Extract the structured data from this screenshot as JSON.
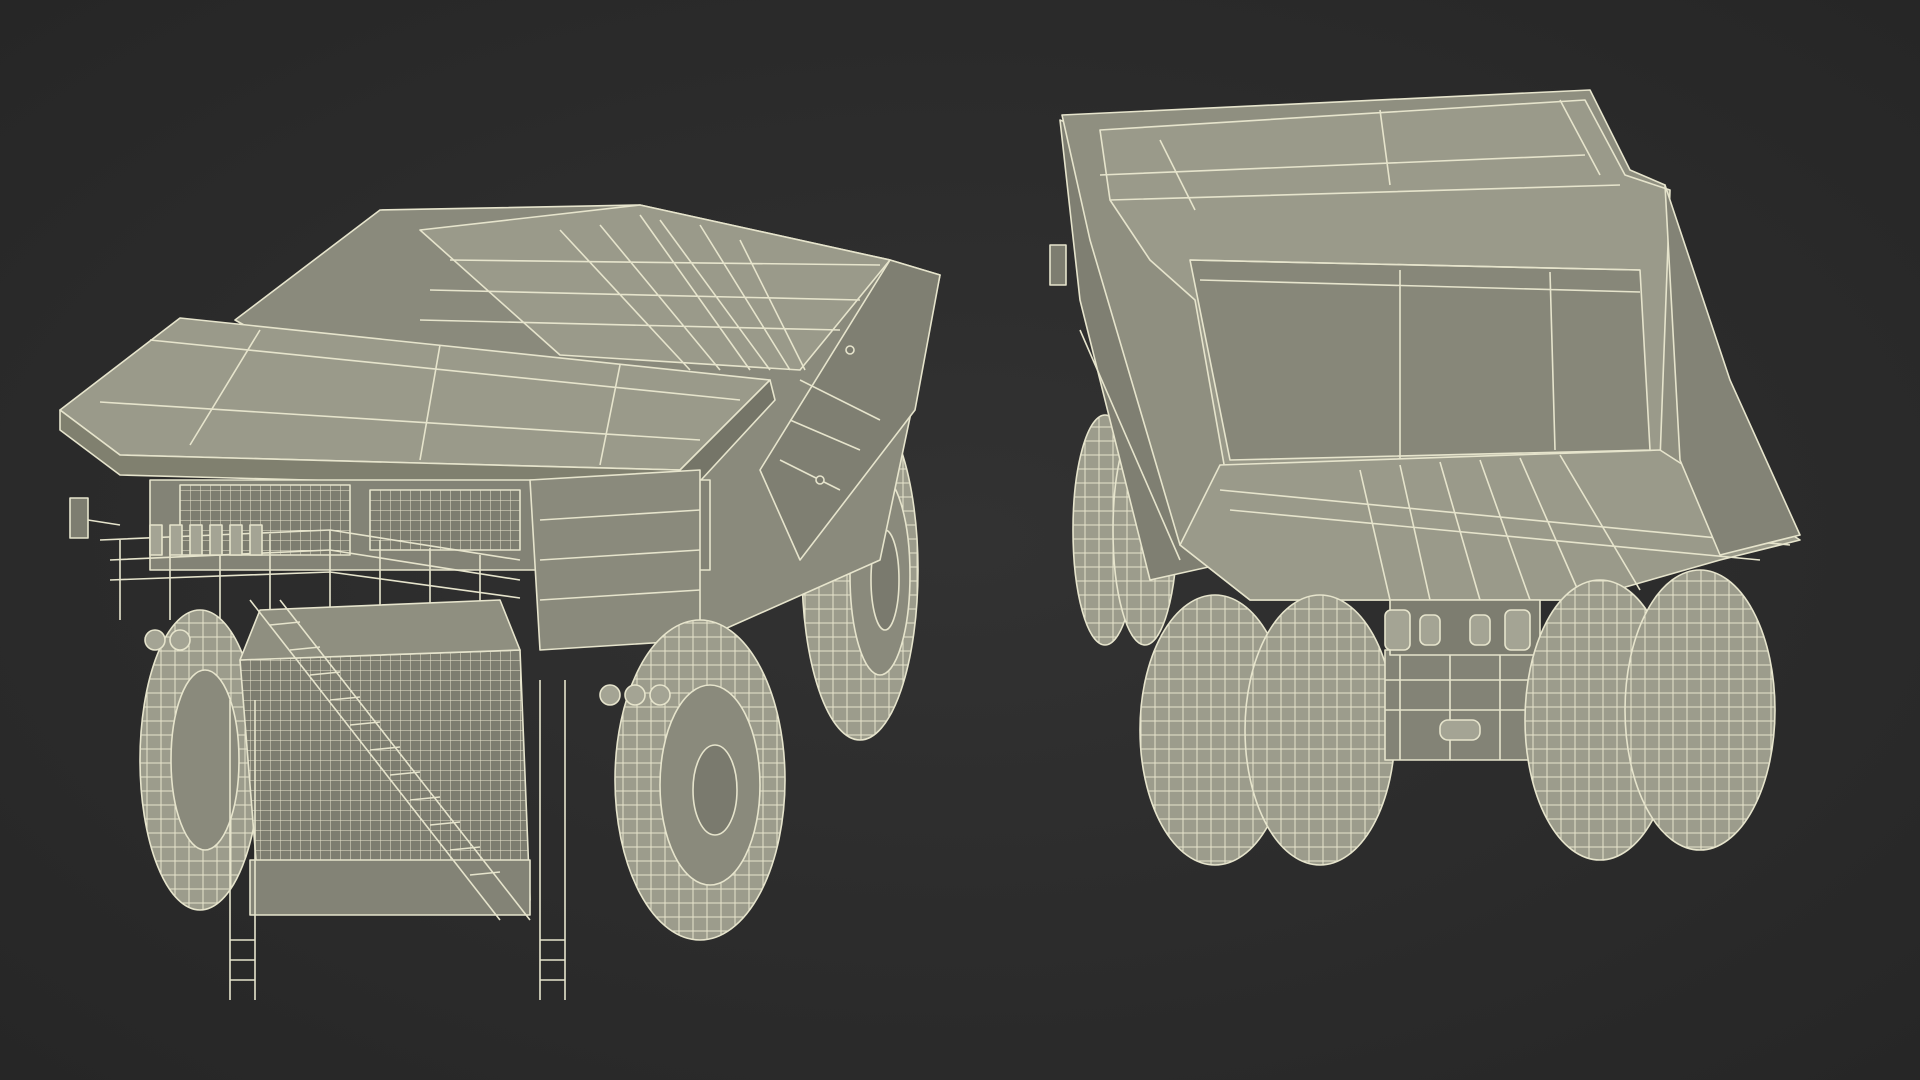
{
  "scene": {
    "background_color": "#2c2c2c",
    "model_fill": "#8f8f80",
    "model_fill_dark": "#6f6f63",
    "model_fill_light": "#a4a494",
    "wire_color": "#e6e4cc",
    "tire_fill": "#9c9c8c"
  },
  "views": [
    {
      "name": "front-three-quarter-view"
    },
    {
      "name": "rear-view"
    }
  ]
}
